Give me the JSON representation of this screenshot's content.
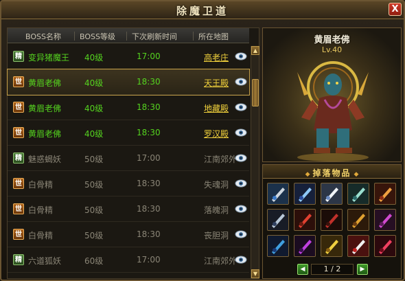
{
  "window": {
    "title": "除魔卫道",
    "close_label": "X"
  },
  "table": {
    "headers": [
      "BOSS名称",
      "BOSS等级",
      "下次刷新时间",
      "所在地图"
    ],
    "rows": [
      {
        "badge": "精",
        "badge_type": "jing",
        "name": "变异猪魔王",
        "level": "40级",
        "time": "17:00",
        "map": "高老庄",
        "state": "active"
      },
      {
        "badge": "世",
        "badge_type": "shi",
        "name": "黄眉老佛",
        "level": "40级",
        "time": "18:30",
        "map": "天王殿",
        "state": "active",
        "selected": true
      },
      {
        "badge": "世",
        "badge_type": "shi",
        "name": "黄眉老佛",
        "level": "40级",
        "time": "18:30",
        "map": "地藏殿",
        "state": "active"
      },
      {
        "badge": "世",
        "badge_type": "shi",
        "name": "黄眉老佛",
        "level": "40级",
        "time": "18:30",
        "map": "罗汉殿",
        "state": "active"
      },
      {
        "badge": "精",
        "badge_type": "jing",
        "name": "魅惑蝎妖",
        "level": "50级",
        "time": "17:00",
        "map": "江南郊外",
        "state": "inactive"
      },
      {
        "badge": "世",
        "badge_type": "shi",
        "name": "白骨精",
        "level": "50级",
        "time": "18:30",
        "map": "失魂洞",
        "state": "inactive"
      },
      {
        "badge": "世",
        "badge_type": "shi",
        "name": "白骨精",
        "level": "50级",
        "time": "18:30",
        "map": "落魄洞",
        "state": "inactive"
      },
      {
        "badge": "世",
        "badge_type": "shi",
        "name": "白骨精",
        "level": "50级",
        "time": "18:30",
        "map": "丧胆洞",
        "state": "inactive"
      },
      {
        "badge": "精",
        "badge_type": "jing",
        "name": "六道狐妖",
        "level": "60级",
        "time": "17:00",
        "map": "江南郊外",
        "state": "inactive"
      }
    ]
  },
  "boss": {
    "name": "黄眉老佛",
    "level": "Lv.40"
  },
  "drops": {
    "title": "掉落物品",
    "items": [
      "sword-icon",
      "blue-sword-icon",
      "white-blade-icon",
      "spear-icon",
      "staff-icon",
      "bow-icon",
      "red-necklace-icon",
      "dark-necklace-icon",
      "gold-necklace-icon",
      "purple-crown-icon",
      "blue-ring-icon",
      "crystal-icon",
      "gold-coins-icon",
      "gift-box-icon",
      "red-gem-icon"
    ],
    "page": "1 / 2"
  },
  "colors": {
    "active_text": "#55d31f",
    "map_link": "#f2d23c",
    "inactive_text": "#8a8576",
    "frame": "#6b5532"
  }
}
